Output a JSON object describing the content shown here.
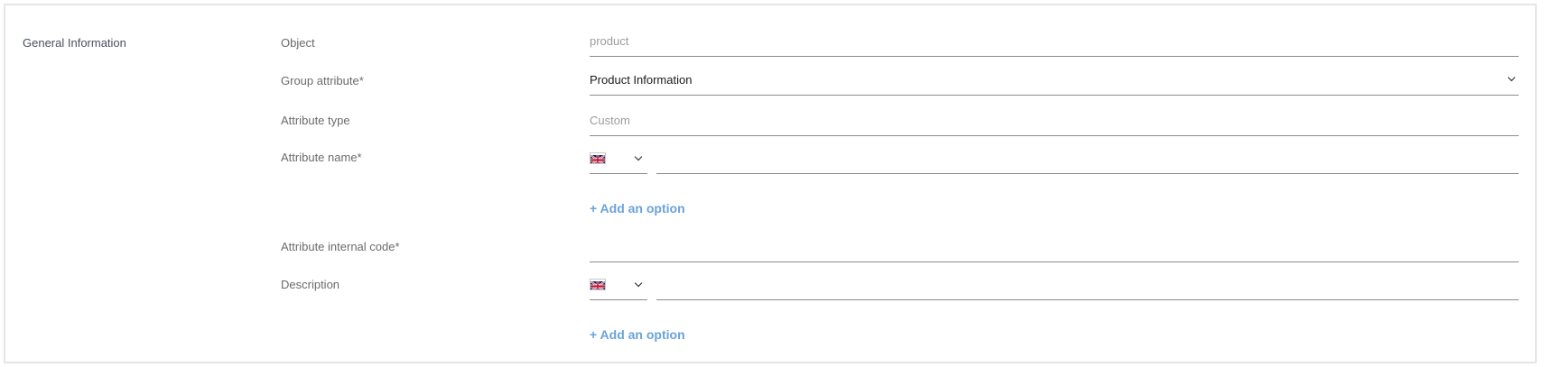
{
  "section": {
    "title": "General Information"
  },
  "fields": {
    "object": {
      "label": "Object",
      "value": "product"
    },
    "group_attribute": {
      "label": "Group attribute*",
      "value": "Product Information"
    },
    "attribute_type": {
      "label": "Attribute type",
      "value": "Custom"
    },
    "attribute_name": {
      "label": "Attribute name*",
      "value": "",
      "language_flag": "uk-flag-icon"
    },
    "attribute_internal_code": {
      "label": "Attribute internal code*",
      "value": ""
    },
    "description": {
      "label": "Description",
      "value": "",
      "language_flag": "uk-flag-icon"
    }
  },
  "actions": {
    "add_option_name": "+ Add an option",
    "add_option_description": "+ Add an option"
  },
  "colors": {
    "accent_link": "#6aa3d9",
    "label": "#6b6b6b",
    "placeholder": "#9c9c9c"
  }
}
